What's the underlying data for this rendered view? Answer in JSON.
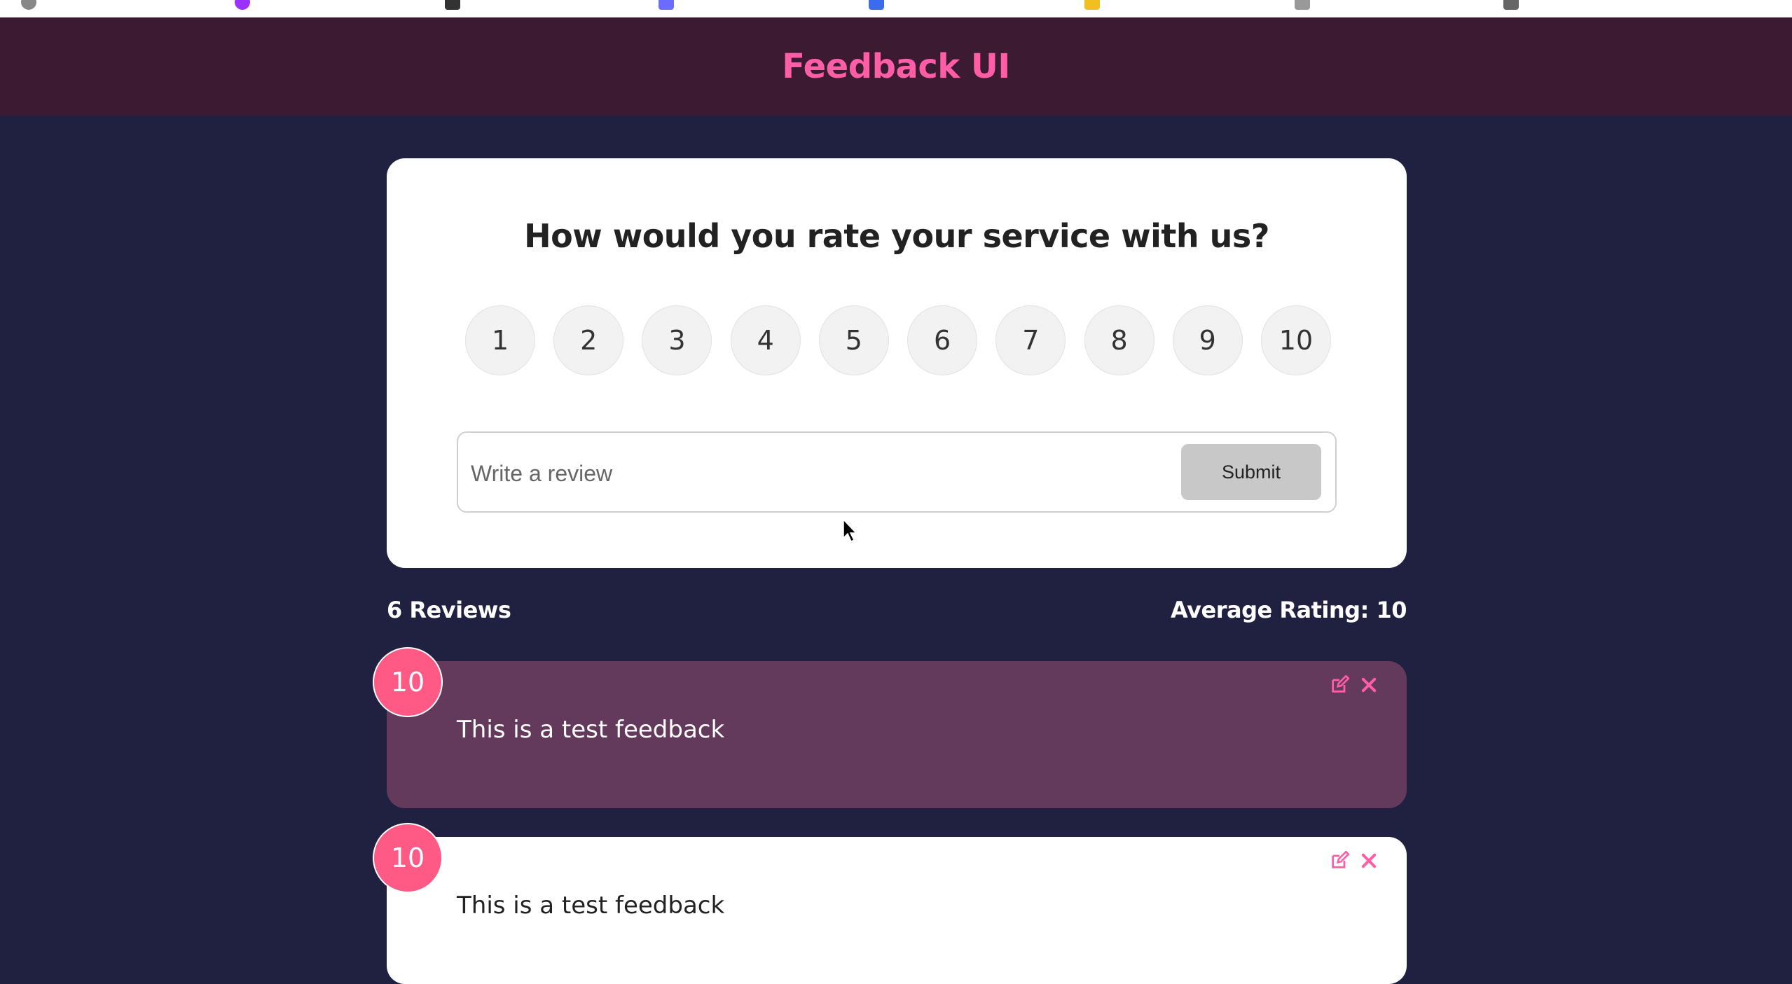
{
  "app": {
    "title": "Feedback UI"
  },
  "colors": {
    "header_bg": "#3b1a32",
    "accent_pink": "#ff5ea6",
    "page_bg": "#202040",
    "highlight_card": "#633a5c",
    "rating_badge": "#ff5986"
  },
  "form": {
    "question": "How would you rate your service with us?",
    "ratings": [
      "1",
      "2",
      "3",
      "4",
      "5",
      "6",
      "7",
      "8",
      "9",
      "10"
    ],
    "input_placeholder": "Write a review",
    "input_value": "",
    "submit_label": "Submit"
  },
  "stats": {
    "count_label": "6 Reviews",
    "average_label": "Average Rating: 10"
  },
  "feedback": [
    {
      "rating": "10",
      "text": "This is a test feedback",
      "edit_icon": "edit-icon",
      "delete_icon": "close-icon"
    },
    {
      "rating": "10",
      "text": "This is a test feedback",
      "edit_icon": "edit-icon",
      "delete_icon": "close-icon"
    }
  ]
}
